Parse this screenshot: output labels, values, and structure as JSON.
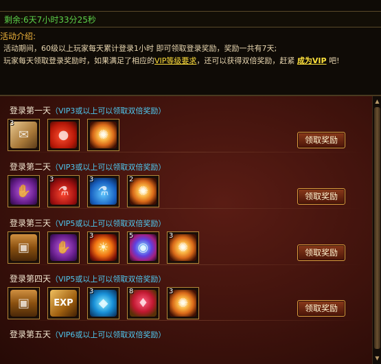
{
  "timer": {
    "label": "剩余:6天7小时33分25秒"
  },
  "intro": {
    "title": "活动介绍:",
    "line1_a": "、活动期间，60级以上玩家每天累计登录1小时 即可领取登录奖励，奖励一共有7天;",
    "line2_a": "、玩家每天领取登录奖励时，如果满足了相应的",
    "line2_vip": "VIP等级要求",
    "line2_b": "，还可以获得双倍奖励，赶紧",
    "line2_link": "成为VIP",
    "line2_c": "吧!"
  },
  "days": [
    {
      "title": "登录第一天",
      "req": "（VIP3或以上可以领取双倍奖励）",
      "items": [
        {
          "icon": "scroll-icon",
          "count": "3"
        },
        {
          "icon": "apple-icon",
          "count": ""
        },
        {
          "icon": "firework-icon",
          "count": ""
        }
      ]
    },
    {
      "title": "登录第二天",
      "req": "（VIP3或以上可以领取双倍奖励）",
      "items": [
        {
          "icon": "glove-icon",
          "count": ""
        },
        {
          "icon": "red-potion-icon",
          "count": "3"
        },
        {
          "icon": "blue-potion-icon",
          "count": "3"
        },
        {
          "icon": "firework-icon",
          "count": "2"
        }
      ]
    },
    {
      "title": "登录第三天",
      "req": "（VIP5或以上可以领取双倍奖励）",
      "items": [
        {
          "icon": "chest-icon",
          "count": ""
        },
        {
          "icon": "glove-icon",
          "count": ""
        },
        {
          "icon": "sun-icon",
          "count": "3"
        },
        {
          "icon": "orb-icon",
          "count": "5"
        },
        {
          "icon": "firework-icon",
          "count": "3"
        }
      ]
    },
    {
      "title": "登录第四天",
      "req": "（VIP5或以上可以领取双倍奖励）",
      "items": [
        {
          "icon": "chest-icon",
          "count": ""
        },
        {
          "icon": "exp-icon",
          "count": ""
        },
        {
          "icon": "egg-icon",
          "count": "3"
        },
        {
          "icon": "gem-icon",
          "count": "8"
        },
        {
          "icon": "firework-icon",
          "count": "3"
        }
      ]
    },
    {
      "title": "登录第五天",
      "req": "（VIP6或以上可以领取双倍奖励）",
      "items": []
    }
  ],
  "claim_label": "领取奖励",
  "exp_text": "EXP"
}
